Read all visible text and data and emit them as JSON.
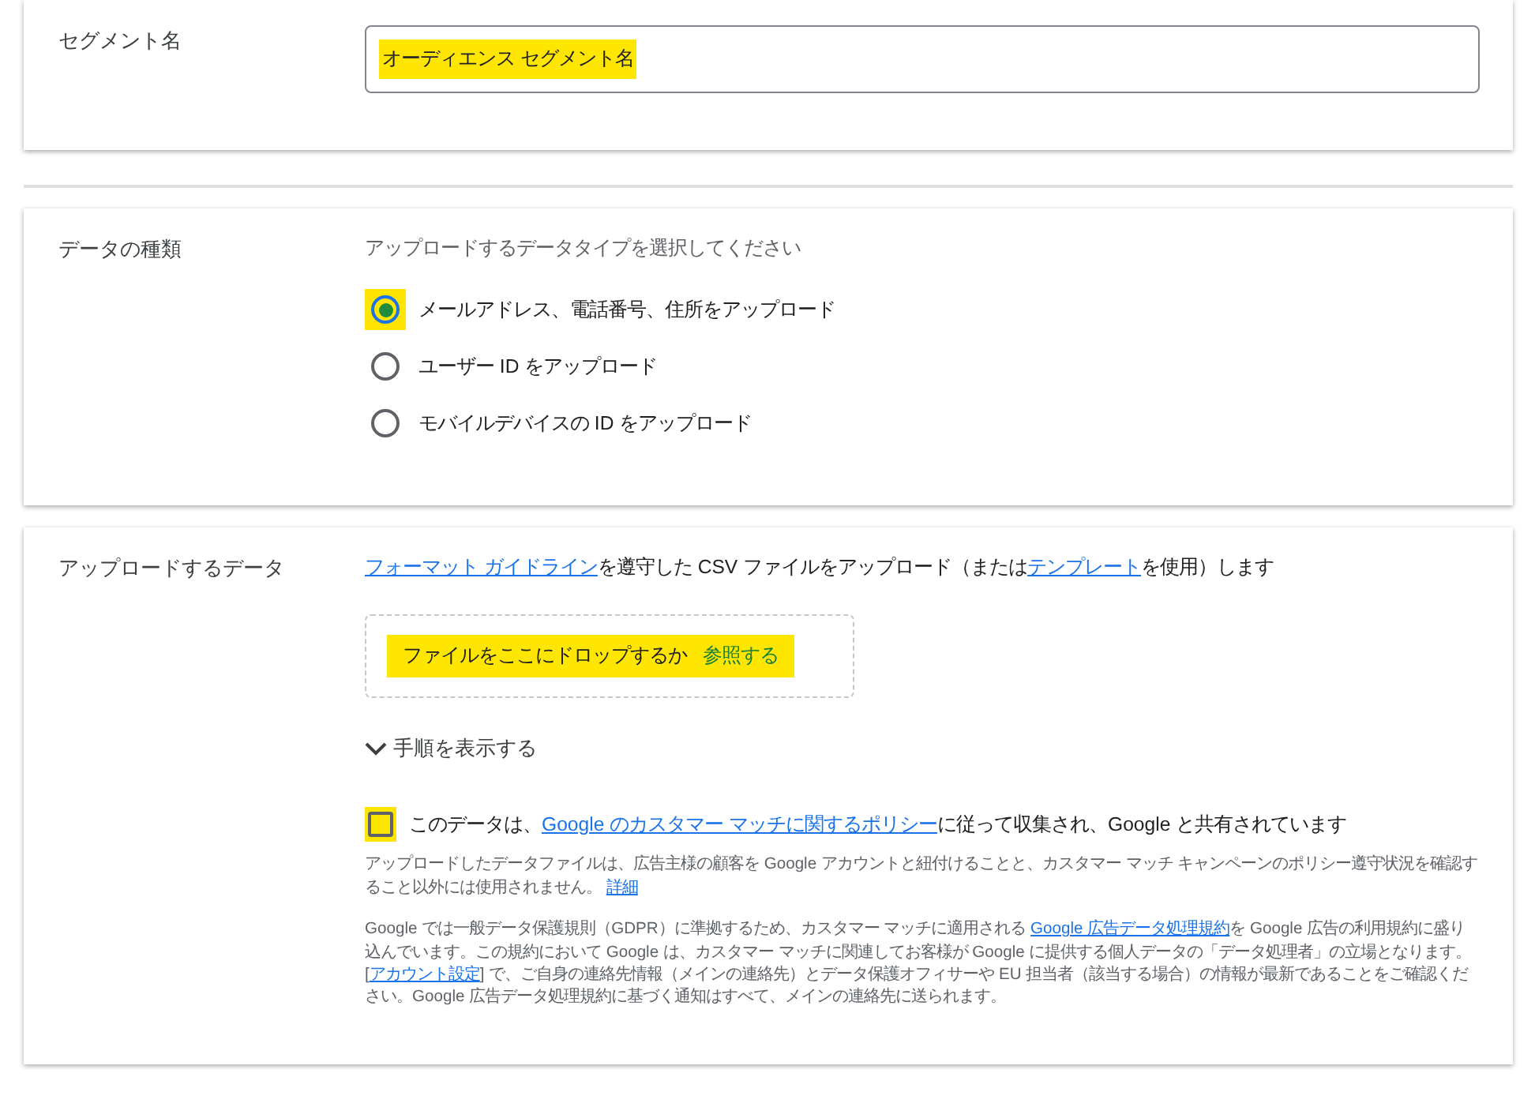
{
  "segment_name": {
    "label": "セグメント名",
    "field": {
      "value": "オーディエンス セグメント名",
      "highlighted": true
    }
  },
  "data_type": {
    "label": "データの種類",
    "prompt": "アップロードするデータタイプを選択してください",
    "options": [
      {
        "label": "メールアドレス、電話番号、住所をアップロード",
        "selected": true,
        "highlighted": true
      },
      {
        "label": "ユーザー ID をアップロード",
        "selected": false,
        "highlighted": false
      },
      {
        "label": "モバイルデバイスの ID をアップロード",
        "selected": false,
        "highlighted": false
      }
    ]
  },
  "upload": {
    "label": "アップロードするデータ",
    "intro": [
      {
        "text": "フォーマット ガイドライン",
        "link": true
      },
      {
        "text": "を遵守した CSV ファイルをアップロード（または",
        "link": false
      },
      {
        "text": "テンプレート",
        "link": true
      },
      {
        "text": "を使用）します",
        "link": false
      }
    ],
    "dropzone": {
      "text": "ファイルをここにドロップするか",
      "browse": "参照する",
      "highlighted": true
    },
    "steps_toggle": {
      "label": "手順を表示する",
      "expanded": false
    },
    "consent": {
      "checked": false,
      "highlighted": true,
      "parts": [
        {
          "text": "このデータは、",
          "link": false
        },
        {
          "text": "Google のカスタマー マッチに関するポリシー",
          "link": true
        },
        {
          "text": "に従って収集され、Google と共有されています",
          "link": false
        }
      ]
    },
    "notes": [
      [
        {
          "text": "アップロードしたデータファイルは、広告主様の顧客を Google アカウントと紐付けることと、カスタマー マッチ キャンペーンのポリシー遵守状況を確認すること以外には使用されません。 ",
          "link": false
        },
        {
          "text": "詳細",
          "link": true
        }
      ],
      [
        {
          "text": "Google では一般データ保護規則（GDPR）に準拠するため、カスタマー マッチに適用される ",
          "link": false
        },
        {
          "text": "Google 広告データ処理規約",
          "link": true
        },
        {
          "text": "を Google 広告の利用規約に盛り込んでいます。この規約において Google は、カスタマー マッチに関連してお客様が Google に提供する個人データの「データ処理者」の立場となります。[",
          "link": false
        },
        {
          "text": "アカウント設定",
          "link": true
        },
        {
          "text": "] で、ご自身の連絡先情報（メインの連絡先）とデータ保護オフィサーや EU 担当者（該当する場合）の情報が最新であることをご確認ください。Google 広告データ処理規約に基づく通知はすべて、メインの連絡先に送られます。",
          "link": false
        }
      ]
    ]
  }
}
